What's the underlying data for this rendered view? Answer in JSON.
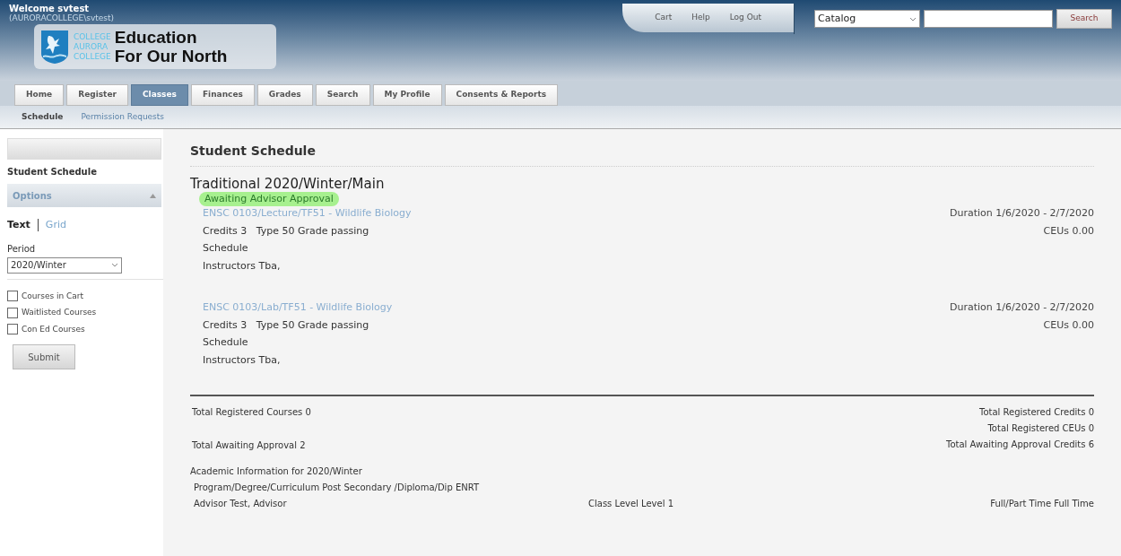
{
  "header": {
    "welcome": "Welcome svtest",
    "account": "(AURORACOLLEGE\\svtest)",
    "logo": {
      "lines": [
        "COLLEGE",
        "AURORA",
        "COLLEGE"
      ],
      "tagline": [
        "Education",
        "For Our North"
      ]
    },
    "links": [
      "Cart",
      "Help",
      "Log Out"
    ],
    "search": {
      "scope": "Catalog",
      "button": "Search"
    }
  },
  "tabs": [
    {
      "label": "Home",
      "selected": false
    },
    {
      "label": "Register",
      "selected": false
    },
    {
      "label": "Classes",
      "selected": true
    },
    {
      "label": "Finances",
      "selected": false
    },
    {
      "label": "Grades",
      "selected": false
    },
    {
      "label": "Search",
      "selected": false
    },
    {
      "label": "My Profile",
      "selected": false
    },
    {
      "label": "Consents & Reports",
      "selected": false
    }
  ],
  "subnav": [
    {
      "label": "Schedule",
      "selected": true
    },
    {
      "label": "Permission Requests",
      "selected": false
    }
  ],
  "sidebar": {
    "heading": "Student Schedule",
    "options_title": "Options",
    "views": [
      {
        "label": "Text",
        "selected": true
      },
      {
        "label": "Grid",
        "selected": false
      }
    ],
    "period_label": "Period",
    "period": "2020/Winter",
    "filters": [
      {
        "label": "Courses in Cart",
        "checked": false
      },
      {
        "label": "Waitlisted Courses",
        "checked": false
      },
      {
        "label": "Con Ed Courses",
        "checked": false
      }
    ],
    "submit": "Submit"
  },
  "main": {
    "title": "Student Schedule",
    "term": "Traditional 2020/Winter/Main",
    "status": "Awaiting Advisor Approval",
    "courses": [
      {
        "link": "ENSC 0103/Lecture/TF51 - Wildlife Biology",
        "details": "Credits 3   Type 50 Grade passing",
        "schedule": "Schedule",
        "instructors": "Instructors Tba,",
        "duration": "Duration 1/6/2020 - 2/7/2020",
        "ceus": "CEUs 0.00"
      },
      {
        "link": "ENSC 0103/Lab/TF51 - Wildlife Biology",
        "details": "Credits 3   Type 50 Grade passing",
        "schedule": "Schedule",
        "instructors": "Instructors Tba,",
        "duration": "Duration 1/6/2020 - 2/7/2020",
        "ceus": "CEUs 0.00"
      }
    ],
    "totals": {
      "registered_courses": "Total Registered Courses 0",
      "registered_credits": "Total Registered Credits 0",
      "registered_ceus": "Total Registered CEUs 0",
      "awaiting": "Total Awaiting Approval 2",
      "awaiting_credits": "Total Awaiting Approval Credits 6"
    },
    "academic": {
      "title": "Academic Information for 2020/Winter",
      "program": "Program/Degree/Curriculum Post Secondary /Diploma/Dip ENRT",
      "advisor": "Advisor Test, Advisor",
      "class_level": "Class Level Level 1",
      "full_part": "Full/Part Time Full Time"
    }
  }
}
